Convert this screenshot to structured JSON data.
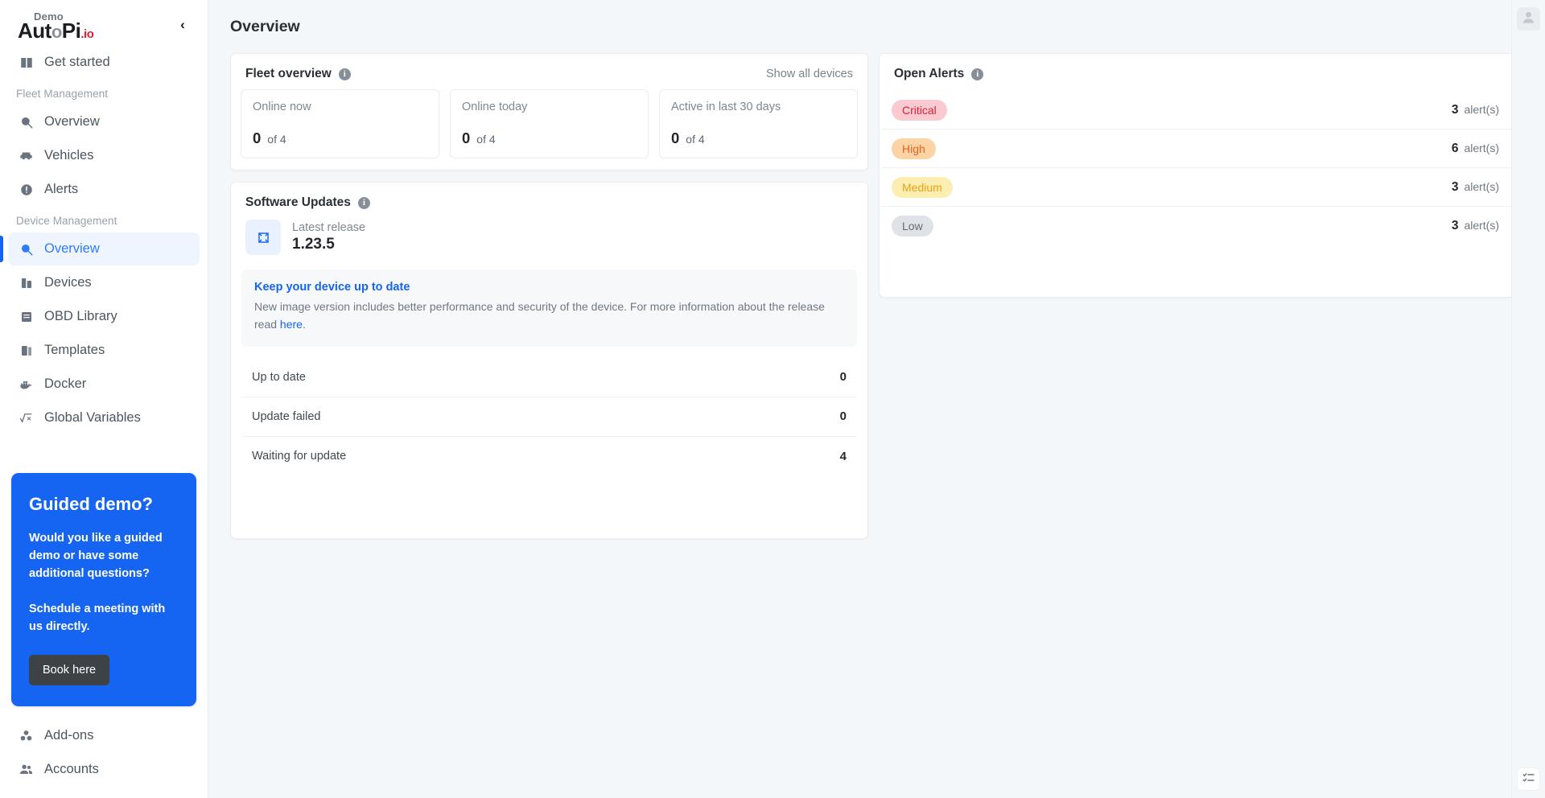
{
  "brand": {
    "demo_label": "Demo",
    "name_part1": "Aut",
    "name_o": "o",
    "name_part2": "Pi",
    "name_tld": ".io",
    "accent_red": "#e11932",
    "accent_blue": "#1565f2"
  },
  "sidebar": {
    "collapse_icon": "‹",
    "top_items": [
      {
        "label": "Get started",
        "icon": "book-icon"
      }
    ],
    "groups": [
      {
        "label": "Fleet Management",
        "items": [
          {
            "label": "Overview",
            "icon": "search-chart-icon",
            "active": false
          },
          {
            "label": "Vehicles",
            "icon": "car-icon",
            "active": false
          },
          {
            "label": "Alerts",
            "icon": "alert-icon",
            "active": false
          }
        ]
      },
      {
        "label": "Device Management",
        "items": [
          {
            "label": "Overview",
            "icon": "search-chart-icon",
            "active": true
          },
          {
            "label": "Devices",
            "icon": "device-icon",
            "active": false
          },
          {
            "label": "OBD Library",
            "icon": "book-stack-icon",
            "active": false
          },
          {
            "label": "Templates",
            "icon": "templates-icon",
            "active": false
          },
          {
            "label": "Docker",
            "icon": "docker-icon",
            "active": false
          },
          {
            "label": "Global Variables",
            "icon": "sqrt-icon",
            "active": false
          }
        ]
      }
    ],
    "promo": {
      "title": "Guided demo?",
      "line1": "Would you like a guided demo or have some additional questions?",
      "line2": "Schedule a meeting with us directly.",
      "button": "Book here",
      "bg_color": "#1565f2",
      "button_color": "#3d4247"
    },
    "bottom_items": [
      {
        "label": "Add-ons",
        "icon": "addons-icon"
      },
      {
        "label": "Accounts",
        "icon": "accounts-icon"
      }
    ]
  },
  "header": {
    "title": "Overview"
  },
  "fleet_overview": {
    "title": "Fleet overview",
    "info_icon": "info-icon",
    "show_all_link": "Show all devices",
    "stats": [
      {
        "label": "Online now",
        "value": "0",
        "of": "of 4"
      },
      {
        "label": "Online today",
        "value": "0",
        "of": "of 4"
      },
      {
        "label": "Active in last 30 days",
        "value": "0",
        "of": "of 4"
      }
    ]
  },
  "software_updates": {
    "title": "Software Updates",
    "info_icon": "info-icon",
    "release_icon": "release-tag-icon",
    "release_label": "Latest release",
    "release_version": "1.23.5",
    "notice": {
      "title": "Keep your device up to date",
      "body_part1": "New image version includes better performance and security of the device. For more information about the release read ",
      "link": "here",
      "body_part2": "."
    },
    "rows": [
      {
        "label": "Up to date",
        "count": "0"
      },
      {
        "label": "Update failed",
        "count": "0"
      },
      {
        "label": "Waiting for update",
        "count": "4"
      }
    ]
  },
  "open_alerts": {
    "title": "Open Alerts",
    "info_icon": "info-icon",
    "unit": "alert(s)",
    "rows": [
      {
        "severity": "Critical",
        "count": "3",
        "bg": "#fbc9d0",
        "fg": "#d32338"
      },
      {
        "severity": "High",
        "count": "6",
        "bg": "#fbd3a5",
        "fg": "#e2641f"
      },
      {
        "severity": "Medium",
        "count": "3",
        "bg": "#fcedb0",
        "fg": "#e8a317"
      },
      {
        "severity": "Low",
        "count": "3",
        "bg": "#dfe3e8",
        "fg": "#5f6974"
      }
    ]
  },
  "right_rail": {
    "avatar_icon": "avatar-icon",
    "tasks_icon": "checklist-icon"
  }
}
